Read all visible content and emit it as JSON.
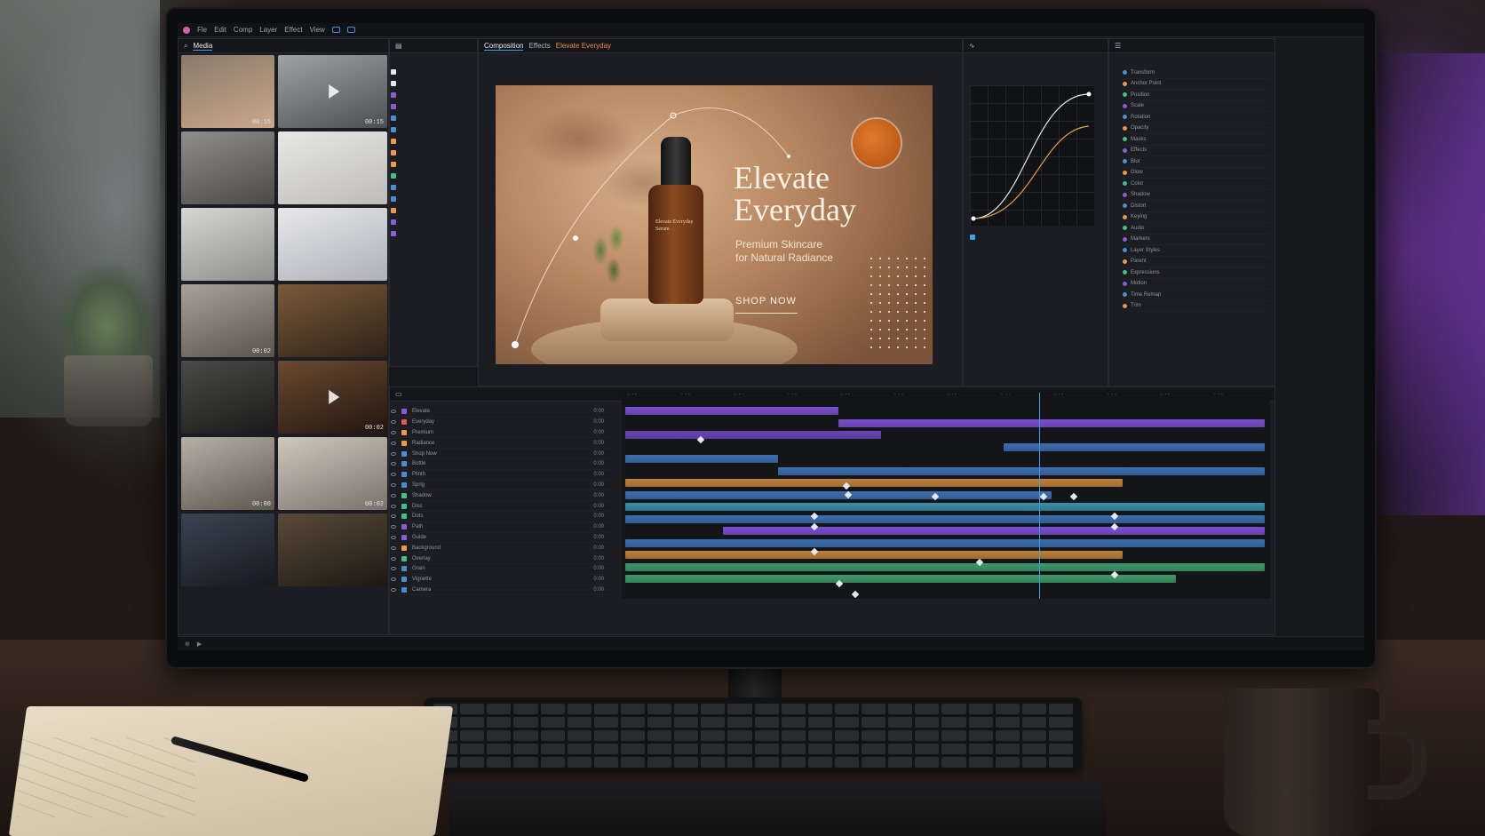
{
  "menubar": {
    "items": [
      "Fle",
      "Edit",
      "Comp",
      "Layer",
      "Effect",
      "View"
    ]
  },
  "media_panel": {
    "title": "Media",
    "thumbs": [
      {
        "subject": "portrait",
        "duration": "00:15",
        "label": "",
        "colors": [
          "#8a7a6c",
          "#caa88a"
        ]
      },
      {
        "subject": "office",
        "duration": "00:15",
        "label": "",
        "colors": [
          "#9da3a4",
          "#4b4f52"
        ]
      },
      {
        "subject": "laptop worker",
        "duration": "",
        "label": "",
        "colors": [
          "#8f8e8a",
          "#4c4a46"
        ]
      },
      {
        "subject": "serum bottle",
        "duration": "",
        "label": "",
        "colors": [
          "#e7e7e6",
          "#bdbcba"
        ]
      },
      {
        "subject": "sneaker",
        "duration": "",
        "label": "",
        "colors": [
          "#d6d6d4",
          "#8e8e8c"
        ]
      },
      {
        "subject": "phone",
        "duration": "",
        "label": "",
        "colors": [
          "#e8e8ea",
          "#aeb0b8"
        ]
      },
      {
        "subject": "kitchen",
        "duration": "00:02",
        "label": "",
        "colors": [
          "#a9a29a",
          "#5a524b"
        ]
      },
      {
        "subject": "dining",
        "duration": "",
        "label": "",
        "colors": [
          "#7a5a3a",
          "#2e2218"
        ]
      },
      {
        "subject": "house",
        "duration": "",
        "label": "",
        "colors": [
          "#4a4a48",
          "#1a1a1a"
        ]
      },
      {
        "subject": "living room",
        "duration": "00:02",
        "label": "",
        "colors": [
          "#6a4a30",
          "#22160f"
        ]
      },
      {
        "subject": "sofa",
        "duration": "00:00",
        "label": "",
        "colors": [
          "#b7b0a5",
          "#5e574f"
        ]
      },
      {
        "subject": "lounge",
        "duration": "00:02",
        "label": "",
        "colors": [
          "#cfc8bc",
          "#7a726a"
        ]
      },
      {
        "subject": "meeting",
        "duration": "",
        "label": "",
        "colors": [
          "#3a4452",
          "#151a22"
        ]
      },
      {
        "subject": "team",
        "duration": "",
        "label": "",
        "colors": [
          "#5a4a3a",
          "#1e1812"
        ]
      }
    ]
  },
  "layers_mini": {
    "swatches": [
      "#e4e7ec",
      "#e4e7ec",
      "#8e5bd8",
      "#8e5bd8",
      "#4b8fcf",
      "#4b8fcf",
      "#e89a4a",
      "#e89a4a",
      "#e89a4a",
      "#3fbf8a",
      "#4b8fcf",
      "#4b8fcf",
      "#e89a4a",
      "#8e5bd8",
      "#8e5bd8"
    ]
  },
  "tabs": {
    "composition": "Composition",
    "effects": "Effects",
    "active": "Elevate Everyday"
  },
  "canvas": {
    "headline_line1": "Elevate",
    "headline_line2": "Everyday",
    "subline_line1": "Premium Skincare",
    "subline_line2": "for Natural Radiance",
    "cta": "SHOP NOW",
    "bottle_label": "Elevate Everyday Serum"
  },
  "colors": {
    "accent": "#3aa0e8",
    "purple": "#7a4fd0",
    "blue": "#3c6fb0",
    "orange": "#c0803a",
    "green": "#3f9a6a",
    "teal": "#3a8fa8"
  },
  "timeline": {
    "ruler_labels": [
      "0:00",
      "0:02",
      "0:04",
      "0:06",
      "0:08",
      "0:10",
      "0:12",
      "0:14",
      "0:16",
      "0:18",
      "0:20",
      "0:22"
    ],
    "layers": [
      {
        "name": "Elevate",
        "color": "#8e5bd8",
        "val": "0:00"
      },
      {
        "name": "Everyday",
        "color": "#e05a5a",
        "val": "0:00"
      },
      {
        "name": "Premium",
        "color": "#e89a4a",
        "val": "0:00"
      },
      {
        "name": "Radiance",
        "color": "#e89a4a",
        "val": "0:00"
      },
      {
        "name": "Shop Now",
        "color": "#4b8fcf",
        "val": "0:00"
      },
      {
        "name": "Bottle",
        "color": "#4b8fcf",
        "val": "0:00"
      },
      {
        "name": "Plinth",
        "color": "#4b8fcf",
        "val": "0:00"
      },
      {
        "name": "Sprig",
        "color": "#4b8fcf",
        "val": "0:00"
      },
      {
        "name": "Shadow",
        "color": "#3fbf8a",
        "val": "0:00"
      },
      {
        "name": "Disc",
        "color": "#3fbf8a",
        "val": "0:00"
      },
      {
        "name": "Dots",
        "color": "#3fbf8a",
        "val": "0:00"
      },
      {
        "name": "Path",
        "color": "#8e5bd8",
        "val": "0:00"
      },
      {
        "name": "Guide",
        "color": "#8e5bd8",
        "val": "0:00"
      },
      {
        "name": "Background",
        "color": "#e89a4a",
        "val": "0:00"
      },
      {
        "name": "Overlay",
        "color": "#3fbf8a",
        "val": "0:00"
      },
      {
        "name": "Grain",
        "color": "#4b8fcf",
        "val": "0:00"
      },
      {
        "name": "Vignette",
        "color": "#4b8fcf",
        "val": "0:00"
      },
      {
        "name": "Camera",
        "color": "#4b8fcf",
        "val": "0:00"
      }
    ]
  },
  "props": {
    "rows": [
      "Transform",
      "Anchor Point",
      "Position",
      "Scale",
      "Rotation",
      "Opacity",
      "Masks",
      "Effects",
      "Blur",
      "Glow",
      "Color",
      "Shadow",
      "Distort",
      "Keying",
      "Audio",
      "Markers",
      "Layer Styles",
      "Parent",
      "Expressions",
      "Motion",
      "Time Remap",
      "Trim"
    ]
  }
}
